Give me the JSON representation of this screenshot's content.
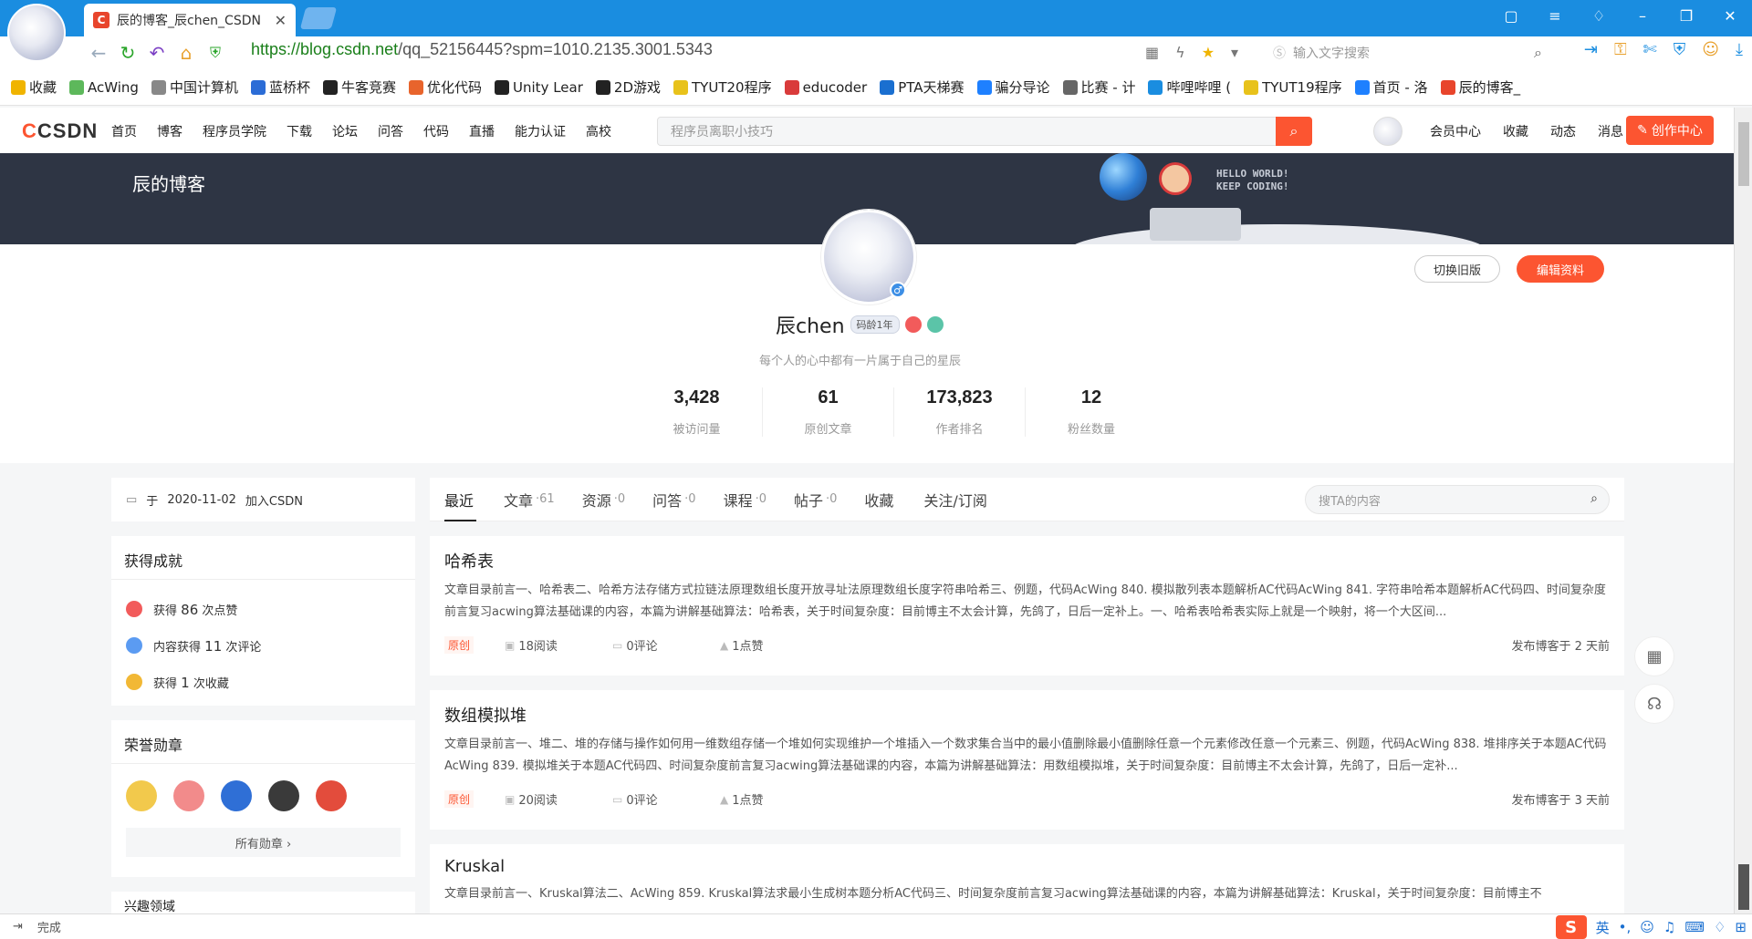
{
  "browser": {
    "tab_title": "辰的博客_辰chen_CSDN",
    "tab_favicon": "C",
    "url_scheme": "https://",
    "url_host": "blog.csdn.net",
    "url_path": "/qq_52156445?spm=1010.2135.3001.5343",
    "search_placeholder": "输入文字搜索",
    "bookmarks": [
      {
        "label": "收藏",
        "icon": "star-icon",
        "color": "#f0b400"
      },
      {
        "label": "AcWing",
        "icon": "acwing-icon",
        "color": "#5db85b"
      },
      {
        "label": "中国计算机",
        "icon": "ccf-icon",
        "color": "#888888"
      },
      {
        "label": "蓝桥杯",
        "icon": "lanqiao-icon",
        "color": "#2b6cd6"
      },
      {
        "label": "牛客竞赛",
        "icon": "nowcoder-icon",
        "color": "#222222"
      },
      {
        "label": "优化代码",
        "icon": "codeopt-icon",
        "color": "#e8642c"
      },
      {
        "label": "Unity Lear",
        "icon": "unity-icon",
        "color": "#222222"
      },
      {
        "label": "2D游戏",
        "icon": "unity-icon",
        "color": "#222222"
      },
      {
        "label": "TYUT20程序",
        "icon": "tyut-icon",
        "color": "#e8c21b"
      },
      {
        "label": "educoder",
        "icon": "educoder-icon",
        "color": "#d93b3b"
      },
      {
        "label": "PTA天梯赛",
        "icon": "pta-icon",
        "color": "#1a6fd0"
      },
      {
        "label": "骗分导论",
        "icon": "juejin-icon",
        "color": "#1e80ff"
      },
      {
        "label": "比赛 - 计",
        "icon": "doc-icon",
        "color": "#666666"
      },
      {
        "label": "哔哩哔哩 (",
        "icon": "bilibili-icon",
        "color": "#1a8de0"
      },
      {
        "label": "TYUT19程序",
        "icon": "tyut-icon",
        "color": "#e8c21b"
      },
      {
        "label": "首页 - 洛",
        "icon": "luogu-icon",
        "color": "#1e80ff"
      },
      {
        "label": "辰的博客_",
        "icon": "csdn-icon",
        "color": "#e8452c"
      }
    ],
    "status_text": "完成"
  },
  "csdn": {
    "logo": "CSDN",
    "nav": [
      "首页",
      "博客",
      "程序员学院",
      "下载",
      "论坛",
      "问答",
      "代码",
      "直播",
      "能力认证",
      "高校"
    ],
    "search_placeholder": "程序员离职小技巧",
    "right_nav": [
      "会员中心",
      "收藏",
      "动态",
      "消息"
    ],
    "create_label": "创作中心"
  },
  "banner": {
    "title": "辰的博客",
    "hello_line1": "HELLO WORLD!",
    "hello_line2": "KEEP CODING!"
  },
  "profile": {
    "name": "辰chen",
    "code_age": "码龄1年",
    "motto": "每个人的心中都有一片属于自己的星辰",
    "switch_old": "切换旧版",
    "edit_profile": "编辑资料",
    "stats": [
      {
        "value": "3,428",
        "label": "被访问量"
      },
      {
        "value": "61",
        "label": "原创文章"
      },
      {
        "value": "173,823",
        "label": "作者排名"
      },
      {
        "value": "12",
        "label": "粉丝数量"
      }
    ]
  },
  "sidebar": {
    "join_prefix": "于",
    "join_date": "2020-11-02",
    "join_suffix": "加入CSDN",
    "achievements_title": "获得成就",
    "achievements": [
      {
        "prefix": "获得",
        "count": "86",
        "suffix": "次点赞",
        "color": "#f25b5b"
      },
      {
        "prefix": "内容获得",
        "count": "11",
        "suffix": "次评论",
        "color": "#5b9bf2"
      },
      {
        "prefix": "获得",
        "count": "1",
        "suffix": "次收藏",
        "color": "#f2b835"
      }
    ],
    "honors_title": "荣誉勋章",
    "medal_colors": [
      "#f2c94c",
      "#f28b8b",
      "#2f6fd6",
      "#3a3a3a",
      "#e34c3c"
    ],
    "all_medals": "所有勋章 ›",
    "next_section": "兴趣领域"
  },
  "content": {
    "tabs": [
      {
        "label": "最近",
        "count": ""
      },
      {
        "label": "文章",
        "count": "·61"
      },
      {
        "label": "资源",
        "count": "·0"
      },
      {
        "label": "问答",
        "count": "·0"
      },
      {
        "label": "课程",
        "count": "·0"
      },
      {
        "label": "帖子",
        "count": "·0"
      },
      {
        "label": "收藏",
        "count": ""
      },
      {
        "label": "关注/订阅",
        "count": ""
      }
    ],
    "search_placeholder": "搜TA的内容",
    "posts": [
      {
        "title": "哈希表",
        "desc": "文章目录前言一、哈希表二、哈希方法存储方式拉链法原理数组长度开放寻址法原理数组长度字符串哈希三、例题，代码AcWing 840. 模拟散列表本题解析AC代码AcWing 841. 字符串哈希本题解析AC代码四、时间复杂度前言复习acwing算法基础课的内容，本篇为讲解基础算法：哈希表，关于时间复杂度：目前博主不太会计算，先鸽了，日后一定补上。一、哈希表哈希表实际上就是一个映射，将一个大区间...",
        "tag": "原创",
        "reads": "18阅读",
        "comments": "0评论",
        "likes": "1点赞",
        "published": "发布博客于 2 天前"
      },
      {
        "title": "数组模拟堆",
        "desc": "文章目录前言一、堆二、堆的存储与操作如何用一维数组存储一个堆如何实现维护一个堆插入一个数求集合当中的最小值删除最小值删除任意一个元素修改任意一个元素三、例题，代码AcWing 838. 堆排序关于本题AC代码AcWing 839. 模拟堆关于本题AC代码四、时间复杂度前言复习acwing算法基础课的内容，本篇为讲解基础算法：用数组模拟堆，关于时间复杂度：目前博主不太会计算，先鸽了，日后一定补...",
        "tag": "原创",
        "reads": "20阅读",
        "comments": "0评论",
        "likes": "1点赞",
        "published": "发布博客于 3 天前"
      },
      {
        "title": "Kruskal",
        "desc": "文章目录前言一、Kruskal算法二、AcWing 859. Kruskal算法求最小生成树本题分析AC代码三、时间复杂度前言复习acwing算法基础课的内容，本篇为讲解基础算法：Kruskal，关于时间复杂度：目前博主不"
      }
    ]
  }
}
